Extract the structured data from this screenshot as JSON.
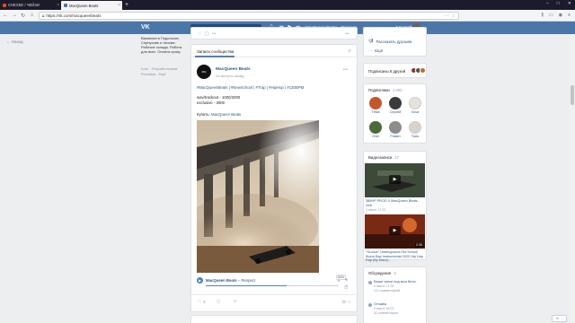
{
  "browser": {
    "tabs": [
      {
        "label": "CHEXEE / ЧЕЙЗИ"
      },
      {
        "label": "MacQueen Beats"
      }
    ],
    "url": "https://vk.com/macqueenbeats"
  },
  "header": {
    "search_placeholder": "Поиск",
    "now_playing": "MacQueen Beats  –  Respect",
    "user_name": "Алексей"
  },
  "sidebar": {
    "back_label": "Назад",
    "ad_text": "Вакансия в Подольске, Серпухове и Чехове. Рабочие склада. Работа для всех. Оплата сразу.",
    "footer_links": [
      "Блог",
      "Разработчикам",
      "Реклама",
      "Ещё"
    ]
  },
  "post": {
    "wall_tab": "Записи сообщества",
    "author": "MacQueen Beats",
    "time": "24 минуты назад",
    "hashtags": "#MacQueenBeats | #NewSchool | #Trap | #HipHop | #130BPM",
    "price1": "wav/trackout - 1000/2000",
    "price2": "exclusive - 3000",
    "buy_label": "Купить:",
    "buy_link": "MacQueen Beats",
    "audio_artist": "MacQueen Beats",
    "audio_title": "Respect",
    "volume_pct": "60%",
    "likes": "3",
    "views": "71"
  },
  "right": {
    "share_label": "Рассказать друзьям",
    "more_label": "Ещё",
    "friends_subscribed": "Подписаны 8 друзей",
    "subscribers_title": "Подписчики",
    "subscribers_count": "1 000",
    "subscribers": [
      {
        "name": "Тёма",
        "color": "#c0582e"
      },
      {
        "name": "Сергей",
        "color": "#3b3b3b"
      },
      {
        "name": "Vova",
        "color": "#e7e2de"
      },
      {
        "name": "Олег",
        "color": "#4a6a3a"
      },
      {
        "name": "Роман",
        "color": "#8d8d8d"
      },
      {
        "name": "Таня",
        "color": "#d9d2cc"
      }
    ],
    "videos_title": "Видеозаписи",
    "videos_count": "17",
    "videos": [
      {
        "title": "389HP PROD X MacQueen Beats - civic",
        "date": "4 мая в 17:23",
        "duration": ""
      },
      {
        "title": "\"Groove\" Underground Old School Boom Bap Instrumental 2020 Hip Hop Rap (By MacQ...",
        "date": "",
        "duration": "2:35"
      }
    ],
    "discussions_title": "Обсуждения",
    "discussions_count": "3",
    "discussions": [
      {
        "title": "Ваши треки под мои биты.",
        "date": "4 мая в 17:26",
        "meta": "121 комментарий"
      },
      {
        "title": "Отзывы",
        "date": "4 мая в 18:03",
        "meta": "42 комментария"
      }
    ]
  },
  "colors": {
    "vk_blue": "#4a76a8",
    "link": "#2a5885",
    "bg": "#edeef0"
  }
}
